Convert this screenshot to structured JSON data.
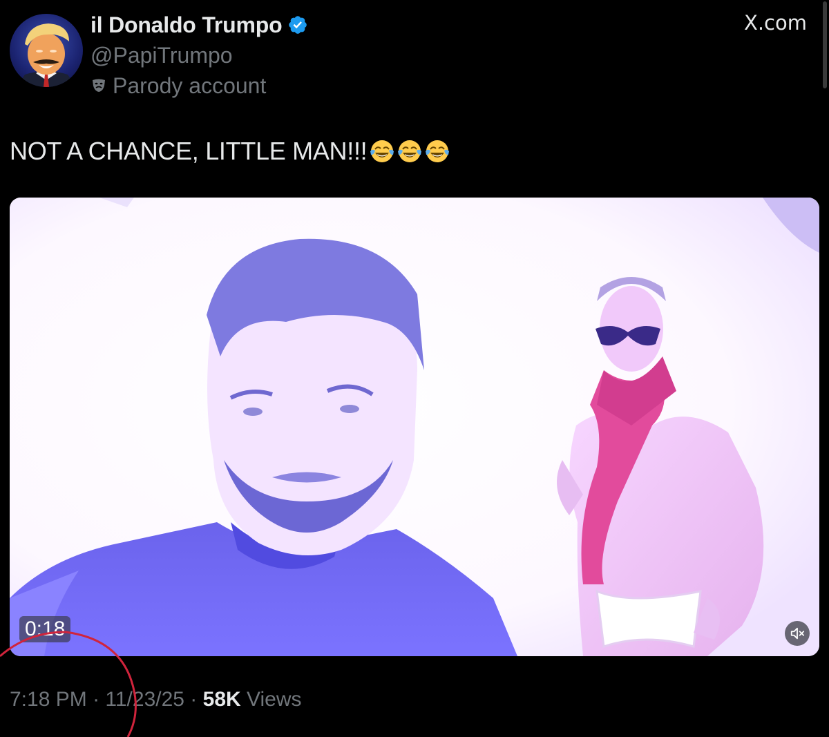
{
  "author": {
    "display_name": "il Donaldo Trumpo",
    "handle": "@PapiTrumpo",
    "label": "Parody account",
    "verified": true
  },
  "site": {
    "label": "X.com"
  },
  "tweet": {
    "text": "NOT A CHANCE, LITTLE MAN!!!",
    "emoji": [
      "face-with-tears-of-joy",
      "face-with-tears-of-joy",
      "face-with-tears-of-joy"
    ]
  },
  "media": {
    "type": "video",
    "duration": "0:18",
    "muted": true
  },
  "meta": {
    "time": "7:18 PM",
    "separator": " · ",
    "date": "11/23/25",
    "views_count": "58K",
    "views_label": " Views"
  },
  "colors": {
    "background": "#000000",
    "primary_text": "#e7e9ea",
    "secondary_text": "#71767b",
    "verified_blue": "#1d9bf0",
    "annotation_red": "#d0243c"
  },
  "icons": {
    "verified": "verified-badge-icon",
    "parody": "theater-mask-icon",
    "mute": "speaker-muted-icon"
  }
}
